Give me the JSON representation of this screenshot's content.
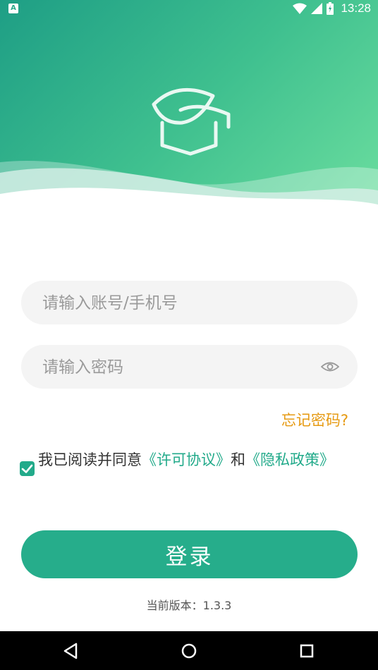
{
  "status_bar": {
    "time": "13:28"
  },
  "login": {
    "account_placeholder": "请输入账号/手机号",
    "password_placeholder": "请输入密码",
    "forgot_password": "忘记密码?",
    "agreement_prefix": "我已阅读并同意",
    "license_link": "《许可协议》",
    "agreement_and": "和",
    "privacy_link": "《隐私政策》",
    "agreement_checked": true,
    "login_button": "登录",
    "version": "当前版本：1.3.3"
  },
  "colors": {
    "accent": "#26ad8b",
    "forgot": "#e69a12"
  }
}
